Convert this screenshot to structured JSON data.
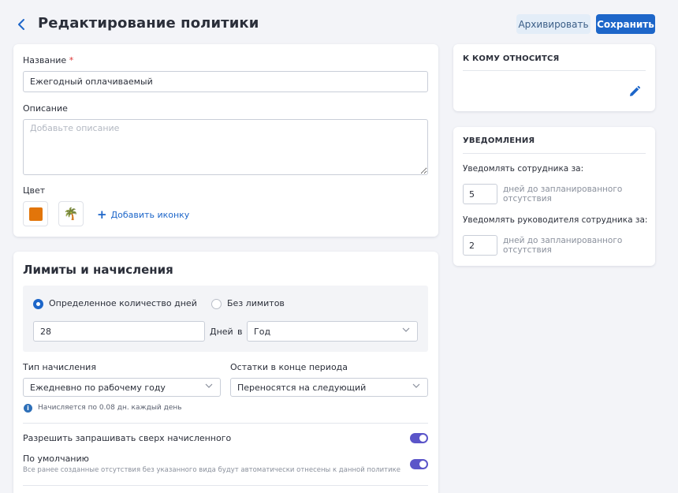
{
  "header": {
    "title": "Редактирование политики",
    "archive_label": "Архивировать",
    "save_label": "Сохранить"
  },
  "general": {
    "name_label": "Название",
    "required_mark": "*",
    "name_value": "Ежегодный оплачиваемый",
    "description_label": "Описание",
    "description_placeholder": "Добавьте описание",
    "color_label": "Цвет",
    "color_value": "#e2750a",
    "icon_glyph": "🌴",
    "add_icon_label": "Добавить иконку"
  },
  "limits": {
    "title": "Лимиты и начисления",
    "option_fixed": "Определенное количество дней",
    "option_unlimited": "Без лимитов",
    "days_value": "28",
    "days_label": "Дней",
    "in_label": "в",
    "period_value": "Год",
    "accrual_type_label": "Тип начисления",
    "accrual_type_value": "Ежедневно по рабочему году",
    "remainder_label": "Остатки в конце периода",
    "remainder_value": "Переносятся на следующий",
    "accrual_info": "Начисляется по 0.08 дн. каждый день",
    "allow_over_label": "Разрешить запрашивать сверх начисленного",
    "default_label": "По умолчанию",
    "default_hint": "Все ранее созданные отсутствия без указанного вида будут автоматически отнесены к данной политике"
  },
  "applies": {
    "title": "К КОМУ ОТНОСИТСЯ"
  },
  "notifications": {
    "title": "УВЕДОМЛЕНИЯ",
    "employee_label": "Уведомлять сотрудника за:",
    "employee_days": "5",
    "manager_label": "Уведомлять руководителя сотрудника за:",
    "manager_days": "2",
    "days_hint": "дней до запланированного отсутствия"
  },
  "colors": {
    "accent": "#1d66c9",
    "toggle_on": "#5b55c9",
    "swatch": "#e2750a"
  }
}
